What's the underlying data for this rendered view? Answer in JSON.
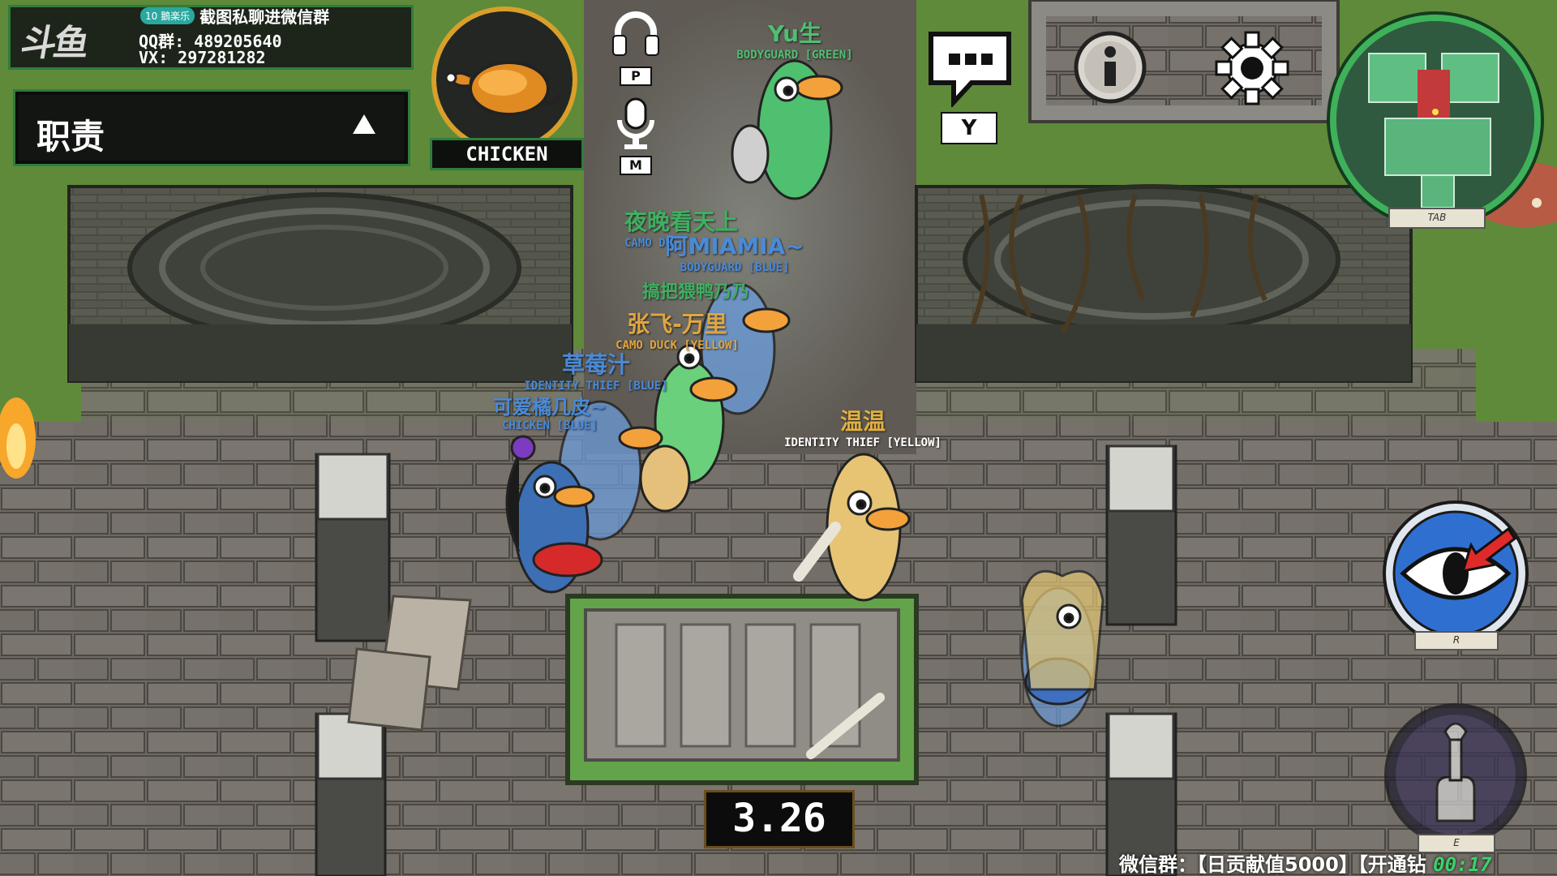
{
  "stream_overlay": {
    "logo_text": "斗鱼",
    "badge": "10 鵝楽乐",
    "top_text": "截图私聊进微信群",
    "qq_label": "QQ群:",
    "qq_value": "489205640",
    "vx_label": "VX:",
    "vx_value": "297281282"
  },
  "duty_panel": {
    "label": "职责"
  },
  "role": {
    "name": "CHICKEN",
    "icon": "roast-chicken-icon"
  },
  "voice_controls": {
    "headphones_key": "P",
    "mic_key": "M"
  },
  "chat": {
    "key": "Y"
  },
  "minimap": {
    "key": "TAB"
  },
  "ability": {
    "key": "R",
    "icon": "eye-icon"
  },
  "use": {
    "key": "E",
    "icon": "wrench-hand-icon"
  },
  "timer": {
    "value": "3.26"
  },
  "ticker": {
    "text": "微信群：【日贡献值5000】【开通钻",
    "clock": "00:17"
  },
  "players": [
    {
      "name": "Yu生",
      "role": "BODYGUARD [GREEN]",
      "name_color": "#4fbf70",
      "role_color": "#4fbf70"
    },
    {
      "name": "夜晚看天上",
      "role": "CAMO DU",
      "name_color": "#3fb060",
      "role_color": "#4a8ad8"
    },
    {
      "name": "阿MIAMIA~",
      "role": "BODYGUARD [BLUE]",
      "name_color": "#4a8ad8",
      "role_color": "#4a8ad8"
    },
    {
      "name": "搞把猥鸭乃乃",
      "role": "",
      "name_color": "#3fb060",
      "role_color": "#3fb060"
    },
    {
      "name": "张飞-万里",
      "role": "CAMO DUCK [YELLOW]",
      "name_color": "#e0a640",
      "role_color": "#e0a640"
    },
    {
      "name": "草莓汁",
      "role": "IDENTITY THIEF [BLUE]",
      "name_color": "#4a8ad8",
      "role_color": "#4a8ad8"
    },
    {
      "name": "可爱橘几皮~",
      "role": "CHICKEN [BLUE]",
      "name_color": "#4a8ad8",
      "role_color": "#4a8ad8"
    },
    {
      "name": "温温",
      "role": "IDENTITY THIEF [YELLOW]",
      "name_color": "#e0b040",
      "role_color": "#ffffff"
    }
  ],
  "colors": {
    "accent_green": "#2f7d3c",
    "timer_border": "#6b4e1d",
    "role_ring": "#d8a02a",
    "ability_blue": "#2f6fd0"
  }
}
